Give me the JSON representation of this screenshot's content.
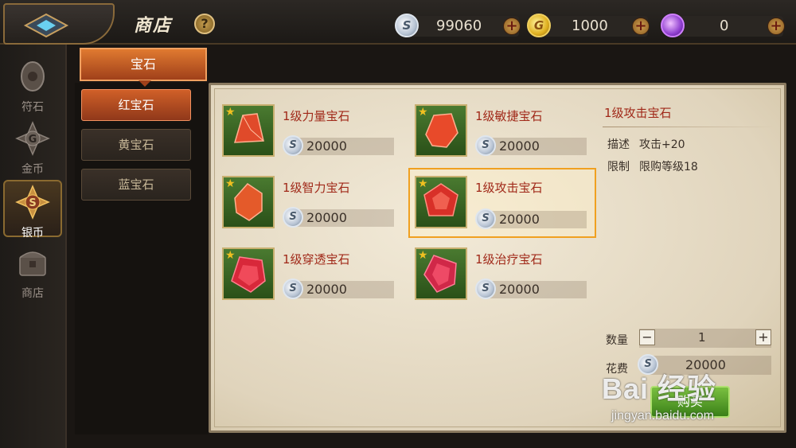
{
  "header": {
    "title": "商店",
    "help_icon": "?",
    "currencies": [
      {
        "icon": "silver-coin",
        "glyph": "S",
        "value": "99060"
      },
      {
        "icon": "gold-coin",
        "glyph": "G",
        "value": "1000"
      },
      {
        "icon": "purple-gem",
        "glyph": "",
        "value": "0"
      }
    ]
  },
  "sidebar": {
    "items": [
      {
        "label": "符石",
        "icon": "rune-icon"
      },
      {
        "label": "金币",
        "icon": "gold-coin-icon"
      },
      {
        "label": "银币",
        "icon": "silver-coin-icon"
      },
      {
        "label": "商店",
        "icon": "shop-chest-icon"
      }
    ],
    "active_index": 2
  },
  "categories": {
    "top_label": "宝石",
    "items": [
      {
        "label": "红宝石"
      },
      {
        "label": "黄宝石"
      },
      {
        "label": "蓝宝石"
      }
    ],
    "active_index": 0
  },
  "items": [
    {
      "name": "1级力量宝石",
      "price": "20000"
    },
    {
      "name": "1级敏捷宝石",
      "price": "20000"
    },
    {
      "name": "1级智力宝石",
      "price": "20000"
    },
    {
      "name": "1级攻击宝石",
      "price": "20000"
    },
    {
      "name": "1级穿透宝石",
      "price": "20000"
    },
    {
      "name": "1级治疗宝石",
      "price": "20000"
    }
  ],
  "detail": {
    "title": "1级攻击宝石",
    "desc_label": "描述",
    "desc_value": "攻击+20",
    "limit_label": "限制",
    "limit_value": "限购等级18",
    "qty_label": "数量",
    "qty_minus": "−",
    "qty_value": "1",
    "qty_plus": "+",
    "cost_label": "花费",
    "cost_value": "20000",
    "buy_label": "购买"
  },
  "watermark": {
    "text": "Bai 经验",
    "sub": "jingyan.baidu.com"
  },
  "colors": {
    "accent_orange": "#d06028",
    "item_name_red": "#a02818",
    "buy_green": "#5aa02a"
  }
}
